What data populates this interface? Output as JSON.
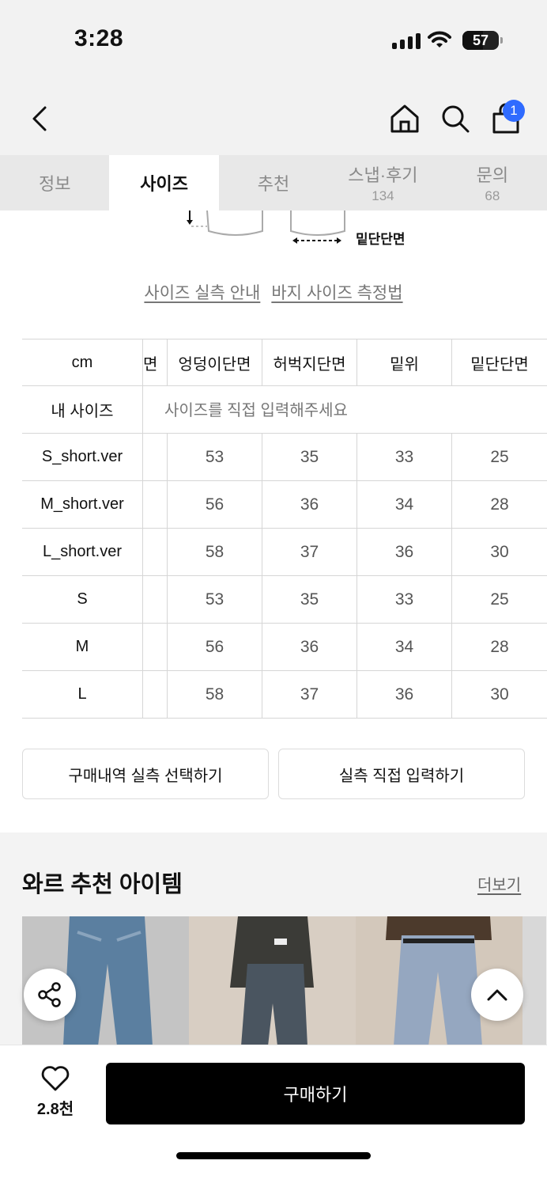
{
  "status_bar": {
    "time": "3:28",
    "battery": "57",
    "battery_level": 0.57
  },
  "nav": {
    "cart_count": "1"
  },
  "tabs": [
    {
      "label": "정보",
      "count": ""
    },
    {
      "label": "사이즈",
      "count": ""
    },
    {
      "label": "추천",
      "count": ""
    },
    {
      "label": "스냅·후기",
      "count": "134"
    },
    {
      "label": "문의",
      "count": "68"
    }
  ],
  "diagram": {
    "label": "밑단단면"
  },
  "guide_links": {
    "actual_size": "사이즈 실측 안내",
    "pants_measure": "바지 사이즈 측정법"
  },
  "size_table": {
    "unit": "cm",
    "cut_header": "면",
    "columns": [
      "엉덩이단면",
      "허벅지단면",
      "밑위",
      "밑단단면"
    ],
    "my_size_label": "내 사이즈",
    "my_size_placeholder": "사이즈를 직접 입력해주세요",
    "rows": [
      {
        "size": "S_short.ver",
        "values": [
          "53",
          "35",
          "33",
          "25"
        ]
      },
      {
        "size": "M_short.ver",
        "values": [
          "56",
          "36",
          "34",
          "28"
        ]
      },
      {
        "size": "L_short.ver",
        "values": [
          "58",
          "37",
          "36",
          "30"
        ]
      },
      {
        "size": "S",
        "values": [
          "53",
          "35",
          "33",
          "25"
        ]
      },
      {
        "size": "M",
        "values": [
          "56",
          "36",
          "34",
          "28"
        ]
      },
      {
        "size": "L",
        "values": [
          "58",
          "37",
          "36",
          "30"
        ]
      }
    ]
  },
  "buttons": {
    "purchase_history": "구매내역 실측 선택하기",
    "direct_input": "실측 직접 입력하기"
  },
  "recommend": {
    "title": "와르 추천 아이템",
    "more": "더보기"
  },
  "bottom": {
    "like_count": "2.8천",
    "buy_label": "구매하기"
  }
}
